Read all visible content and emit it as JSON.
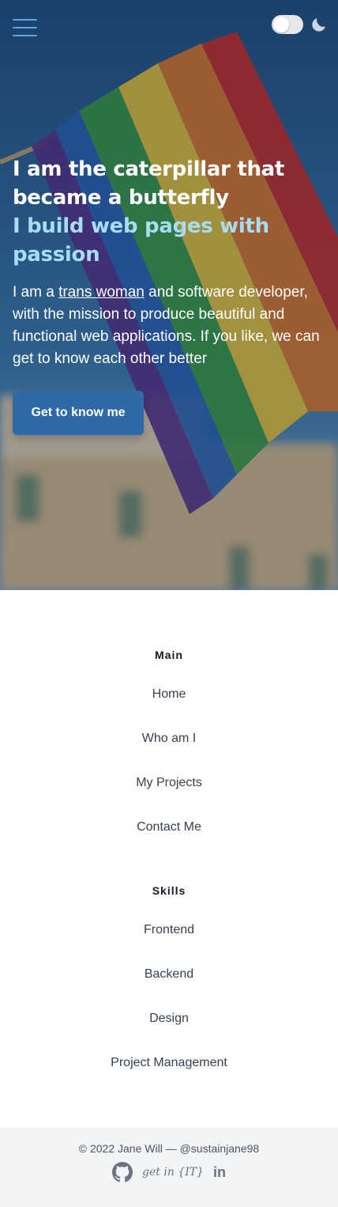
{
  "header": {
    "menu_icon": "hamburger-icon",
    "theme_toggle_state": "off",
    "theme_icon": "moon-icon"
  },
  "hero": {
    "headline": "I am the caterpillar that became a butterfly",
    "subheadline": "I build web pages with passion",
    "intro_prefix": "I am a ",
    "intro_link": "trans woman",
    "intro_suffix": " and software developer, with the mission to produce beautiful and functional web applications. If you like, we can get to know each other better",
    "cta_label": "Get to know me",
    "colors": {
      "headline": "#ffffff",
      "subheadline": "#a8dcf2",
      "cta_bg": "#2f6aa8"
    }
  },
  "nav": {
    "main": {
      "title": "Main",
      "items": [
        "Home",
        "Who am I",
        "My Projects",
        "Contact Me"
      ]
    },
    "skills": {
      "title": "Skills",
      "items": [
        "Frontend",
        "Backend",
        "Design",
        "Project Management"
      ]
    }
  },
  "footer": {
    "copyright": "© 2022 Jane Will — @sustainjane98",
    "socials": {
      "github_icon": "github-icon",
      "getinit_label": "get in {IT}",
      "linkedin_label": "in"
    }
  }
}
